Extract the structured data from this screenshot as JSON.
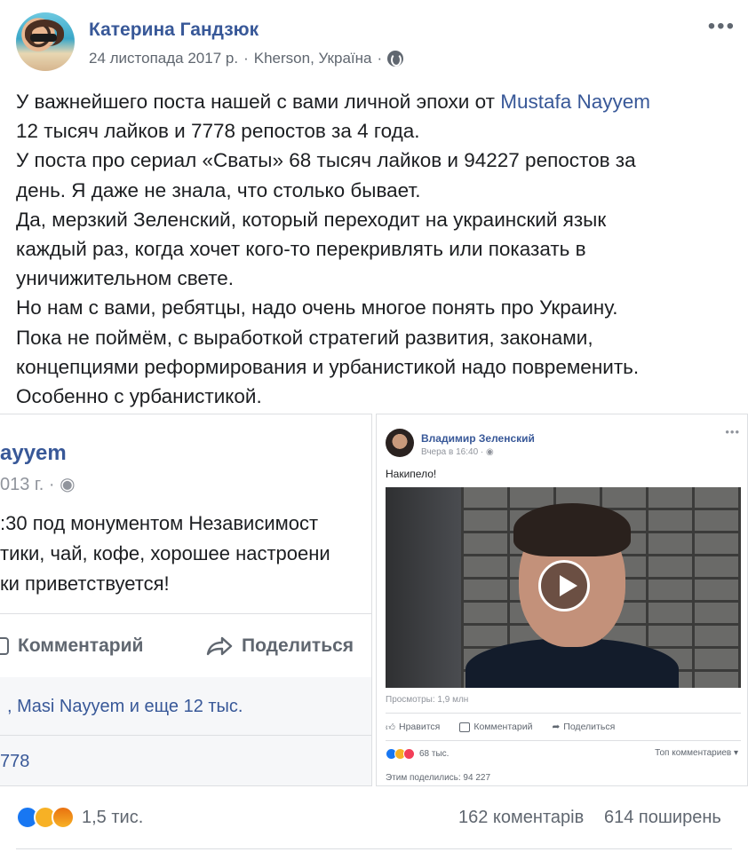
{
  "post": {
    "author": "Катерина Гандзюк",
    "date": "24 листопада 2017 р.",
    "separator": "·",
    "location": "Kherson, Україна",
    "privacy_icon": "globe-icon",
    "more_icon": "more-dots-icon",
    "lines": [
      {
        "before": "У важнейшего поста нашей с вами личной эпохи от ",
        "link": "Mustafa Nayyem"
      },
      {
        "text": "12 тысяч лайков и 7778 репостов за 4 года."
      },
      {
        "text": "У поста про сериал «Сваты» 68 тысяч лайков и 94227 репостов за"
      },
      {
        "text": "день. Я даже не знала, что столько бывает."
      },
      {
        "text": "Да, мерзкий Зеленский, который переходит на украинский язык"
      },
      {
        "text": "каждый раз, когда хочет кого-то перекривлять или показать в"
      },
      {
        "text": "уничижительном свете."
      },
      {
        "text": "Но нам с вами, ребятцы, надо очень многое понять про Украину."
      },
      {
        "text": "Пока не поймём, с выработкой стратегий развития, законами,"
      },
      {
        "text": "концепциями реформирования и урбанистикой надо повременить."
      },
      {
        "text": "Особенно с урбанистикой."
      }
    ]
  },
  "left_card": {
    "name": "ayyem",
    "date": "013 г. · ",
    "lines": [
      ":30 под монументом Независимост",
      "тики, чай, кофе, хорошее настроени",
      "ки приветствуется!"
    ],
    "comment_label": "Комментарий",
    "share_label": "Поделиться",
    "likes_text": ", Masi Nayyem и еще 12 тыс.",
    "shares_text": "778"
  },
  "right_card": {
    "name": "Владимир Зеленский",
    "time": "Вчера в 16:40 · ",
    "text": "Накипело!",
    "views": "Просмотры: 1,9 млн",
    "like_label": "Нравится",
    "comment_label": "Комментарий",
    "share_label": "Поделиться",
    "reactions_count": "68 тыс.",
    "top_comments": "Топ комментариев ▾",
    "shared": "Этим поделились: 94 227"
  },
  "footer": {
    "reactions_count": "1,5 тис.",
    "comments": "162 коментарів",
    "shares": "614 поширень"
  },
  "colors": {
    "link": "#385898",
    "text": "#1c1e21",
    "muted": "#606770",
    "like_blue": "#1877f2",
    "sad_yellow": "#f7b125",
    "angry_orange": "#e9710f"
  }
}
